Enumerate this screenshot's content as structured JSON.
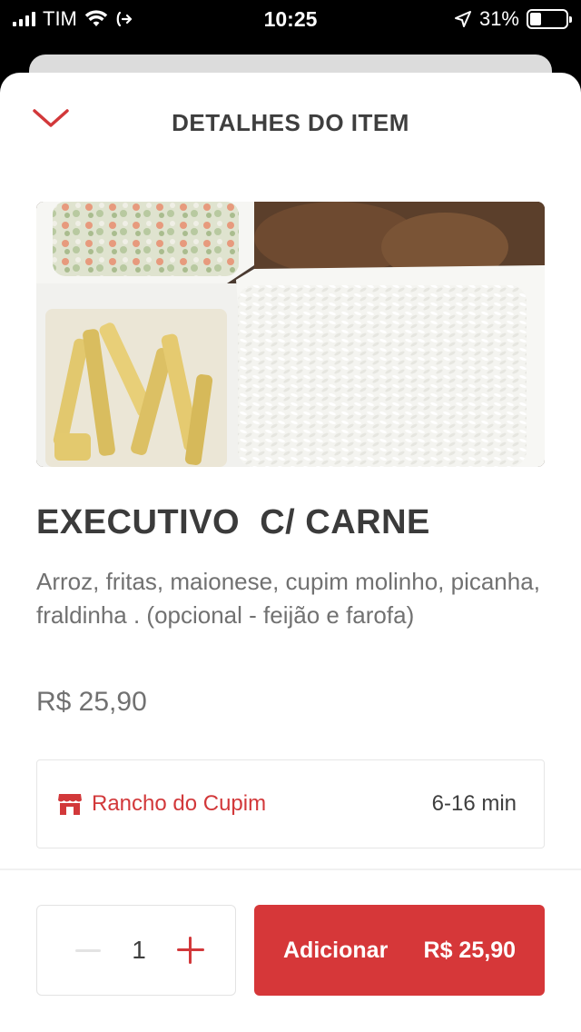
{
  "status_bar": {
    "carrier": "TIM",
    "time": "10:25",
    "battery": "31%",
    "battery_level": 0.31
  },
  "sheet": {
    "title": "DETALHES DO ITEM",
    "collapse_icon": "chevron-down-icon",
    "accent_color": "#d2383a"
  },
  "item": {
    "name": "EXECUTIVO  C/ CARNE",
    "description": "Arroz, fritas, maionese, cupim molinho, picanha, fraldinha . (opcional - feijão e farofa)",
    "price": "R$ 25,90"
  },
  "store": {
    "icon": "store-icon",
    "name": "Rancho do Cupim",
    "delivery_time": "6-16 min"
  },
  "footer": {
    "quantity": "1",
    "minus_icon": "minus-icon",
    "plus_icon": "plus-icon",
    "add_label": "Adicionar",
    "add_price": "R$ 25,90"
  }
}
